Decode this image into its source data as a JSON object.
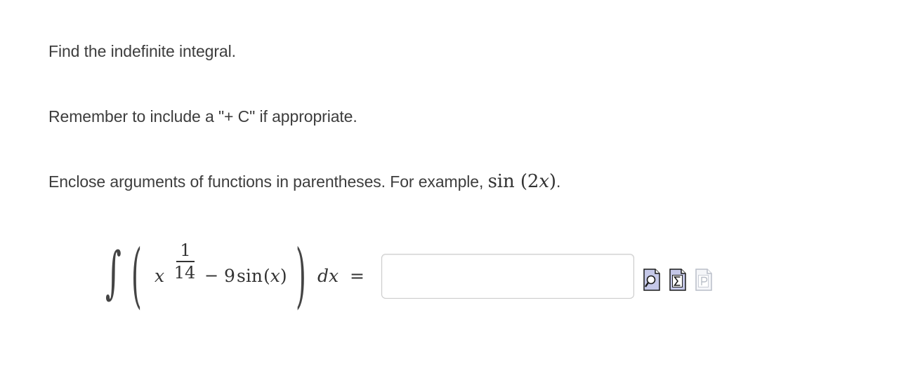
{
  "instructions": {
    "line1": "Find the indefinite integral.",
    "line2": "Remember to include a \"+ C\" if appropriate.",
    "line3_text": "Enclose arguments of functions in parentheses. For example, ",
    "line3_math": "sin (2x)",
    "line3_math_fn": "sin",
    "line3_math_open": " (",
    "line3_math_num": "2",
    "line3_math_var": "x",
    "line3_math_close": ")",
    "line3_end": "."
  },
  "problem": {
    "integral_sign": "∫",
    "open_paren": "(",
    "base": "x",
    "exponent_numerator": "1",
    "exponent_denominator": "14",
    "minus": "−",
    "coefficient": "9",
    "function": "sin",
    "arg_open": " (",
    "arg_var": "x",
    "arg_close": ")",
    "close_paren": ")",
    "differential": "dx",
    "equals": "="
  },
  "answer": {
    "value": "",
    "placeholder": ""
  },
  "tools": {
    "preview_icon": "preview-magnifier-icon",
    "equation_icon": "equation-sigma-icon",
    "paste_icon": "paste-p-icon",
    "icon_fill": "#c5c8e8",
    "icon_stroke": "#1a1a1a",
    "disabled_color": "#b9bec8"
  }
}
